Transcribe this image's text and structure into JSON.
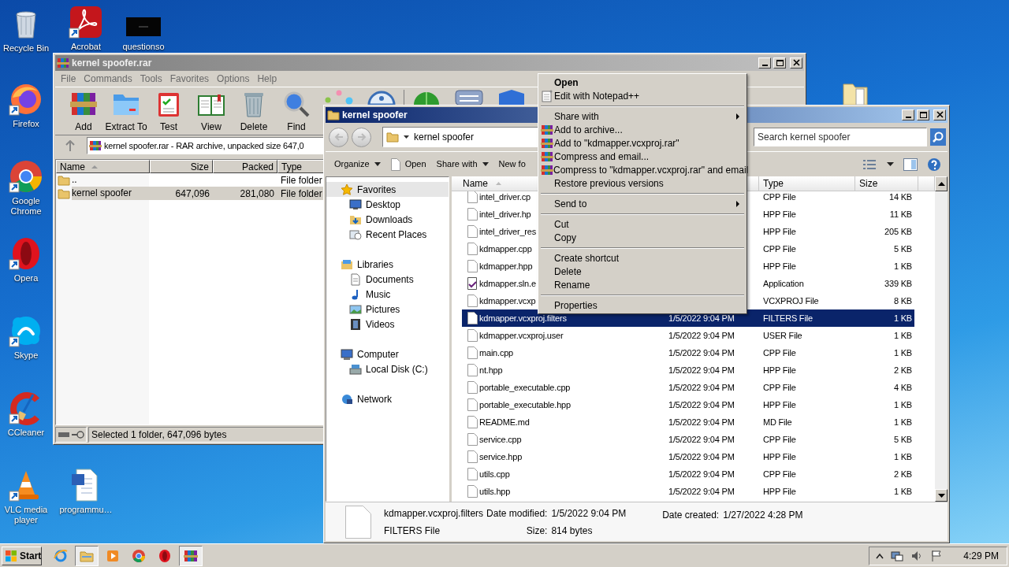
{
  "desktop_icons": [
    {
      "label": "Recycle Bin",
      "kind": "trash",
      "shortcut": false
    },
    {
      "label": "Firefox",
      "kind": "firefox",
      "shortcut": true
    },
    {
      "label": "Google Chrome",
      "kind": "chrome",
      "shortcut": true
    },
    {
      "label": "Opera",
      "kind": "opera",
      "shortcut": true
    },
    {
      "label": "Skype",
      "kind": "skype",
      "shortcut": true
    },
    {
      "label": "CCleaner",
      "kind": "ccleaner",
      "shortcut": true
    },
    {
      "label": "VLC media player",
      "kind": "vlc",
      "shortcut": true
    },
    {
      "label": "Acrobat",
      "kind": "pdf",
      "shortcut": true
    },
    {
      "label": "questionso",
      "kind": "thumbnail",
      "shortcut": false
    },
    {
      "label": "programmu…",
      "kind": "word",
      "shortcut": false
    }
  ],
  "winrar": {
    "title": "kernel spoofer.rar",
    "menu": [
      "File",
      "Commands",
      "Tools",
      "Favorites",
      "Options",
      "Help"
    ],
    "toolbar": [
      {
        "kind": "add",
        "label": "Add"
      },
      {
        "kind": "extract",
        "label": "Extract To"
      },
      {
        "kind": "test",
        "label": "Test"
      },
      {
        "kind": "view",
        "label": "View"
      },
      {
        "kind": "delete",
        "label": "Delete"
      },
      {
        "kind": "find",
        "label": "Find"
      },
      {
        "kind": "wizard"
      },
      {
        "kind": "info"
      },
      {
        "kind": "scan"
      },
      {
        "kind": "comment"
      },
      {
        "kind": "protect"
      }
    ],
    "address": "kernel spoofer.rar - RAR archive, unpacked size 647,0",
    "columns": [
      "Name",
      "Size",
      "Packed",
      "Type"
    ],
    "rows": [
      {
        "name": "..",
        "size": "",
        "packed": "",
        "type": "File folder",
        "selected": false
      },
      {
        "name": "kernel spoofer",
        "size": "647,096",
        "packed": "281,080",
        "type": "File folder",
        "selected": true
      }
    ],
    "status": "Selected 1 folder, 647,096 bytes"
  },
  "explorer": {
    "title": "kernel spoofer",
    "breadcrumb": "kernel spoofer",
    "search": {
      "placeholder": "Search kernel spoofer"
    },
    "commands": [
      {
        "label": "Organize",
        "dropdown": true,
        "icon": false
      },
      {
        "label": "Open",
        "dropdown": false,
        "icon": true
      },
      {
        "label": "Share with",
        "dropdown": true,
        "icon": false
      },
      {
        "label": "New fo",
        "dropdown": false,
        "icon": false
      }
    ],
    "nav": [
      {
        "label": "Favorites",
        "kind": "star",
        "selected": true,
        "children": [
          {
            "label": "Desktop",
            "kind": "desktop",
            "selected": false
          },
          {
            "label": "Downloads",
            "kind": "downloads",
            "selected": false
          },
          {
            "label": "Recent Places",
            "kind": "recent",
            "selected": false
          }
        ]
      },
      {
        "label": "Libraries",
        "kind": "libraries",
        "selected": false,
        "children": [
          {
            "label": "Documents",
            "kind": "documents",
            "selected": false
          },
          {
            "label": "Music",
            "kind": "music",
            "selected": false
          },
          {
            "label": "Pictures",
            "kind": "pictures",
            "selected": false
          },
          {
            "label": "Videos",
            "kind": "videos",
            "selected": false
          }
        ]
      },
      {
        "label": "Computer",
        "kind": "computer",
        "selected": false,
        "children": [
          {
            "label": "Local Disk (C:)",
            "kind": "disk",
            "selected": false
          }
        ]
      },
      {
        "label": "Network",
        "kind": "network",
        "selected": false
      }
    ],
    "columns": {
      "name": "Name",
      "type": "Type",
      "size": "Size"
    },
    "files": [
      {
        "name": "intel_driver.cp",
        "type": "CPP File",
        "size": "14 KB",
        "kind": "file",
        "selected": false
      },
      {
        "name": "intel_driver.hp",
        "type": "HPP File",
        "size": "11 KB",
        "kind": "file",
        "selected": false
      },
      {
        "name": "intel_driver_res",
        "type": "HPP File",
        "size": "205 KB",
        "kind": "file",
        "selected": false
      },
      {
        "name": "kdmapper.cpp",
        "type": "CPP File",
        "size": "5 KB",
        "kind": "file",
        "selected": false
      },
      {
        "name": "kdmapper.hpp",
        "type": "HPP File",
        "size": "1 KB",
        "kind": "file",
        "selected": false
      },
      {
        "name": "kdmapper.sln.e",
        "type": "Application",
        "size": "339 KB",
        "kind": "solution",
        "selected": false
      },
      {
        "name": "kdmapper.vcxp",
        "type": "VCXPROJ File",
        "size": "8 KB",
        "kind": "file",
        "selected": false
      },
      {
        "name": "kdmapper.vcxproj.filters",
        "date": "1/5/2022 9:04 PM",
        "type": "FILTERS File",
        "size": "1 KB",
        "kind": "file",
        "selected": true
      },
      {
        "name": "kdmapper.vcxproj.user",
        "date": "1/5/2022 9:04 PM",
        "type": "USER File",
        "size": "1 KB",
        "kind": "file",
        "selected": false
      },
      {
        "name": "main.cpp",
        "date": "1/5/2022 9:04 PM",
        "type": "CPP File",
        "size": "1 KB",
        "kind": "file",
        "selected": false
      },
      {
        "name": "nt.hpp",
        "date": "1/5/2022 9:04 PM",
        "type": "HPP File",
        "size": "2 KB",
        "kind": "file",
        "selected": false
      },
      {
        "name": "portable_executable.cpp",
        "date": "1/5/2022 9:04 PM",
        "type": "CPP File",
        "size": "4 KB",
        "kind": "file",
        "selected": false
      },
      {
        "name": "portable_executable.hpp",
        "date": "1/5/2022 9:04 PM",
        "type": "HPP File",
        "size": "1 KB",
        "kind": "file",
        "selected": false
      },
      {
        "name": "README.md",
        "date": "1/5/2022 9:04 PM",
        "type": "MD File",
        "size": "1 KB",
        "kind": "file",
        "selected": false
      },
      {
        "name": "service.cpp",
        "date": "1/5/2022 9:04 PM",
        "type": "CPP File",
        "size": "5 KB",
        "kind": "file",
        "selected": false
      },
      {
        "name": "service.hpp",
        "date": "1/5/2022 9:04 PM",
        "type": "HPP File",
        "size": "1 KB",
        "kind": "file",
        "selected": false
      },
      {
        "name": "utils.cpp",
        "date": "1/5/2022 9:04 PM",
        "type": "CPP File",
        "size": "2 KB",
        "kind": "file",
        "selected": false
      },
      {
        "name": "utils.hpp",
        "date": "1/5/2022 9:04 PM",
        "type": "HPP File",
        "size": "1 KB",
        "kind": "file",
        "selected": false
      }
    ],
    "details": {
      "name": "kdmapper.vcxproj.filters",
      "type": "FILTERS File",
      "fields": [
        {
          "label": "Date modified:",
          "value": "1/5/2022 9:04 PM"
        },
        {
          "label": "Size:",
          "value": "814 bytes"
        },
        {
          "label": "Date created:",
          "value": "1/27/2022 4:28 PM"
        }
      ]
    }
  },
  "context_menu": [
    {
      "label": "Open",
      "kind": "default"
    },
    {
      "label": "Edit with Notepad++",
      "kind": "notepad"
    },
    {
      "kind": "separator"
    },
    {
      "label": "Share with",
      "kind": "submenu"
    },
    {
      "label": "Add to archive...",
      "kind": "archive"
    },
    {
      "label": "Add to \"kdmapper.vcxproj.rar\"",
      "kind": "archive"
    },
    {
      "label": "Compress and email...",
      "kind": "archive"
    },
    {
      "label": "Compress to \"kdmapper.vcxproj.rar\" and email",
      "kind": "archive"
    },
    {
      "label": "Restore previous versions",
      "kind": "item"
    },
    {
      "kind": "separator"
    },
    {
      "label": "Send to",
      "kind": "submenu"
    },
    {
      "kind": "separator"
    },
    {
      "label": "Cut",
      "kind": "item"
    },
    {
      "label": "Copy",
      "kind": "item"
    },
    {
      "kind": "separator"
    },
    {
      "label": "Create shortcut",
      "kind": "item"
    },
    {
      "label": "Delete",
      "kind": "item"
    },
    {
      "label": "Rename",
      "kind": "item"
    },
    {
      "kind": "separator"
    },
    {
      "label": "Properties",
      "kind": "item"
    }
  ],
  "taskbar": {
    "start": "Start",
    "apps": [
      {
        "kind": "ie",
        "selected": false
      },
      {
        "kind": "explorer",
        "selected": true
      },
      {
        "kind": "media",
        "selected": false
      },
      {
        "kind": "chrome",
        "selected": false
      },
      {
        "kind": "opera",
        "selected": false
      },
      {
        "kind": "winrar",
        "selected": true
      }
    ],
    "clock": "4:29 PM"
  }
}
